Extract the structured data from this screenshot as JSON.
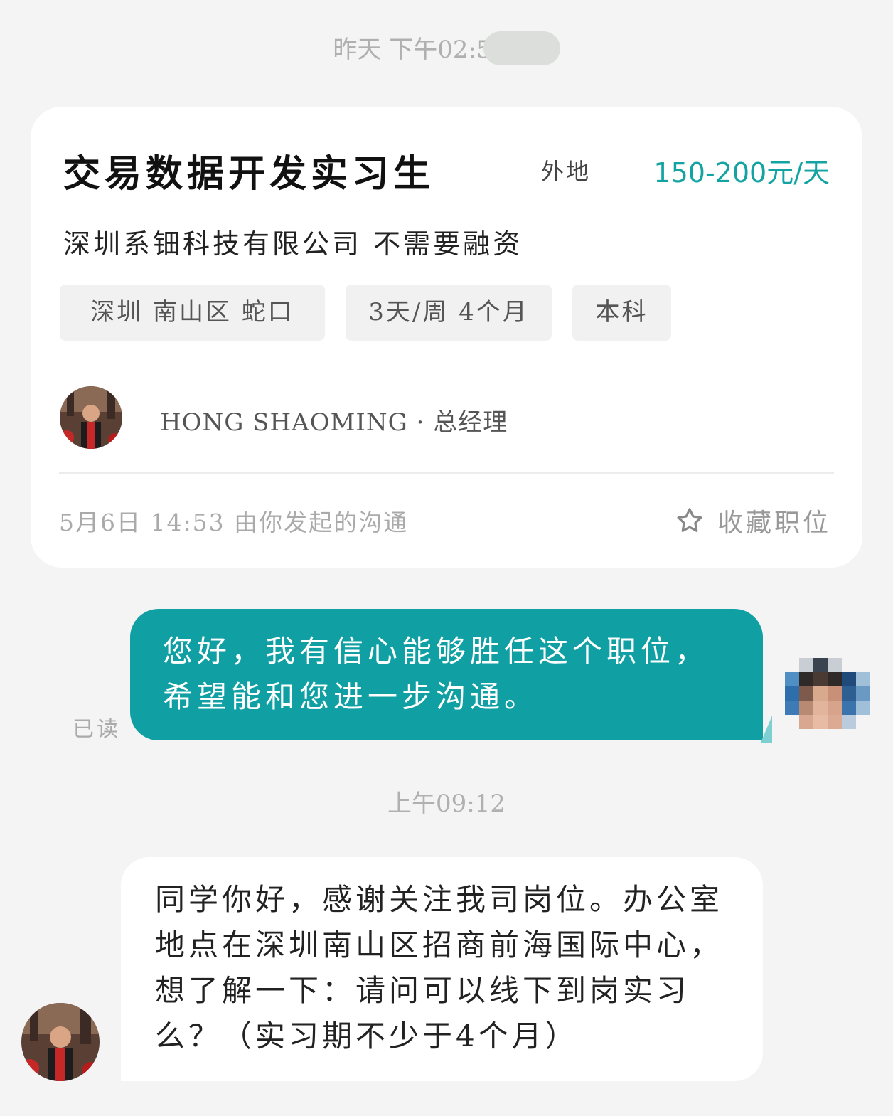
{
  "timestamps": {
    "top": "昨天 下午02:5",
    "middle": "上午09:12"
  },
  "job": {
    "title": "交易数据开发实习生",
    "location": "外地",
    "salary": "150-200元/天",
    "company": "深圳系钿科技有限公司 不需要融资",
    "tags": [
      "深圳 南山区 蛇口",
      "3天/周 4个月",
      "本科"
    ],
    "recruiter": "HONG SHAOMING · 总经理",
    "footer_note": "5月6日 14:53 由你发起的沟通",
    "favorite_label": "收藏职位"
  },
  "messages": {
    "outgoing_text": "您好，我有信心能够胜任这个职位，希望能和您进一步沟通。",
    "read_status": "已读",
    "incoming_text": "同学你好，感谢关注我司岗位。办公室地点在深圳南山区招商前海国际中心，想了解一下：请问可以线下到岗实习么？（实习期不少于4个月）"
  },
  "icons": {
    "favorite": "star-outline-icon"
  },
  "colors": {
    "accent": "#10a0a4",
    "salary": "#14a3a3",
    "background": "#f4f4f4"
  }
}
